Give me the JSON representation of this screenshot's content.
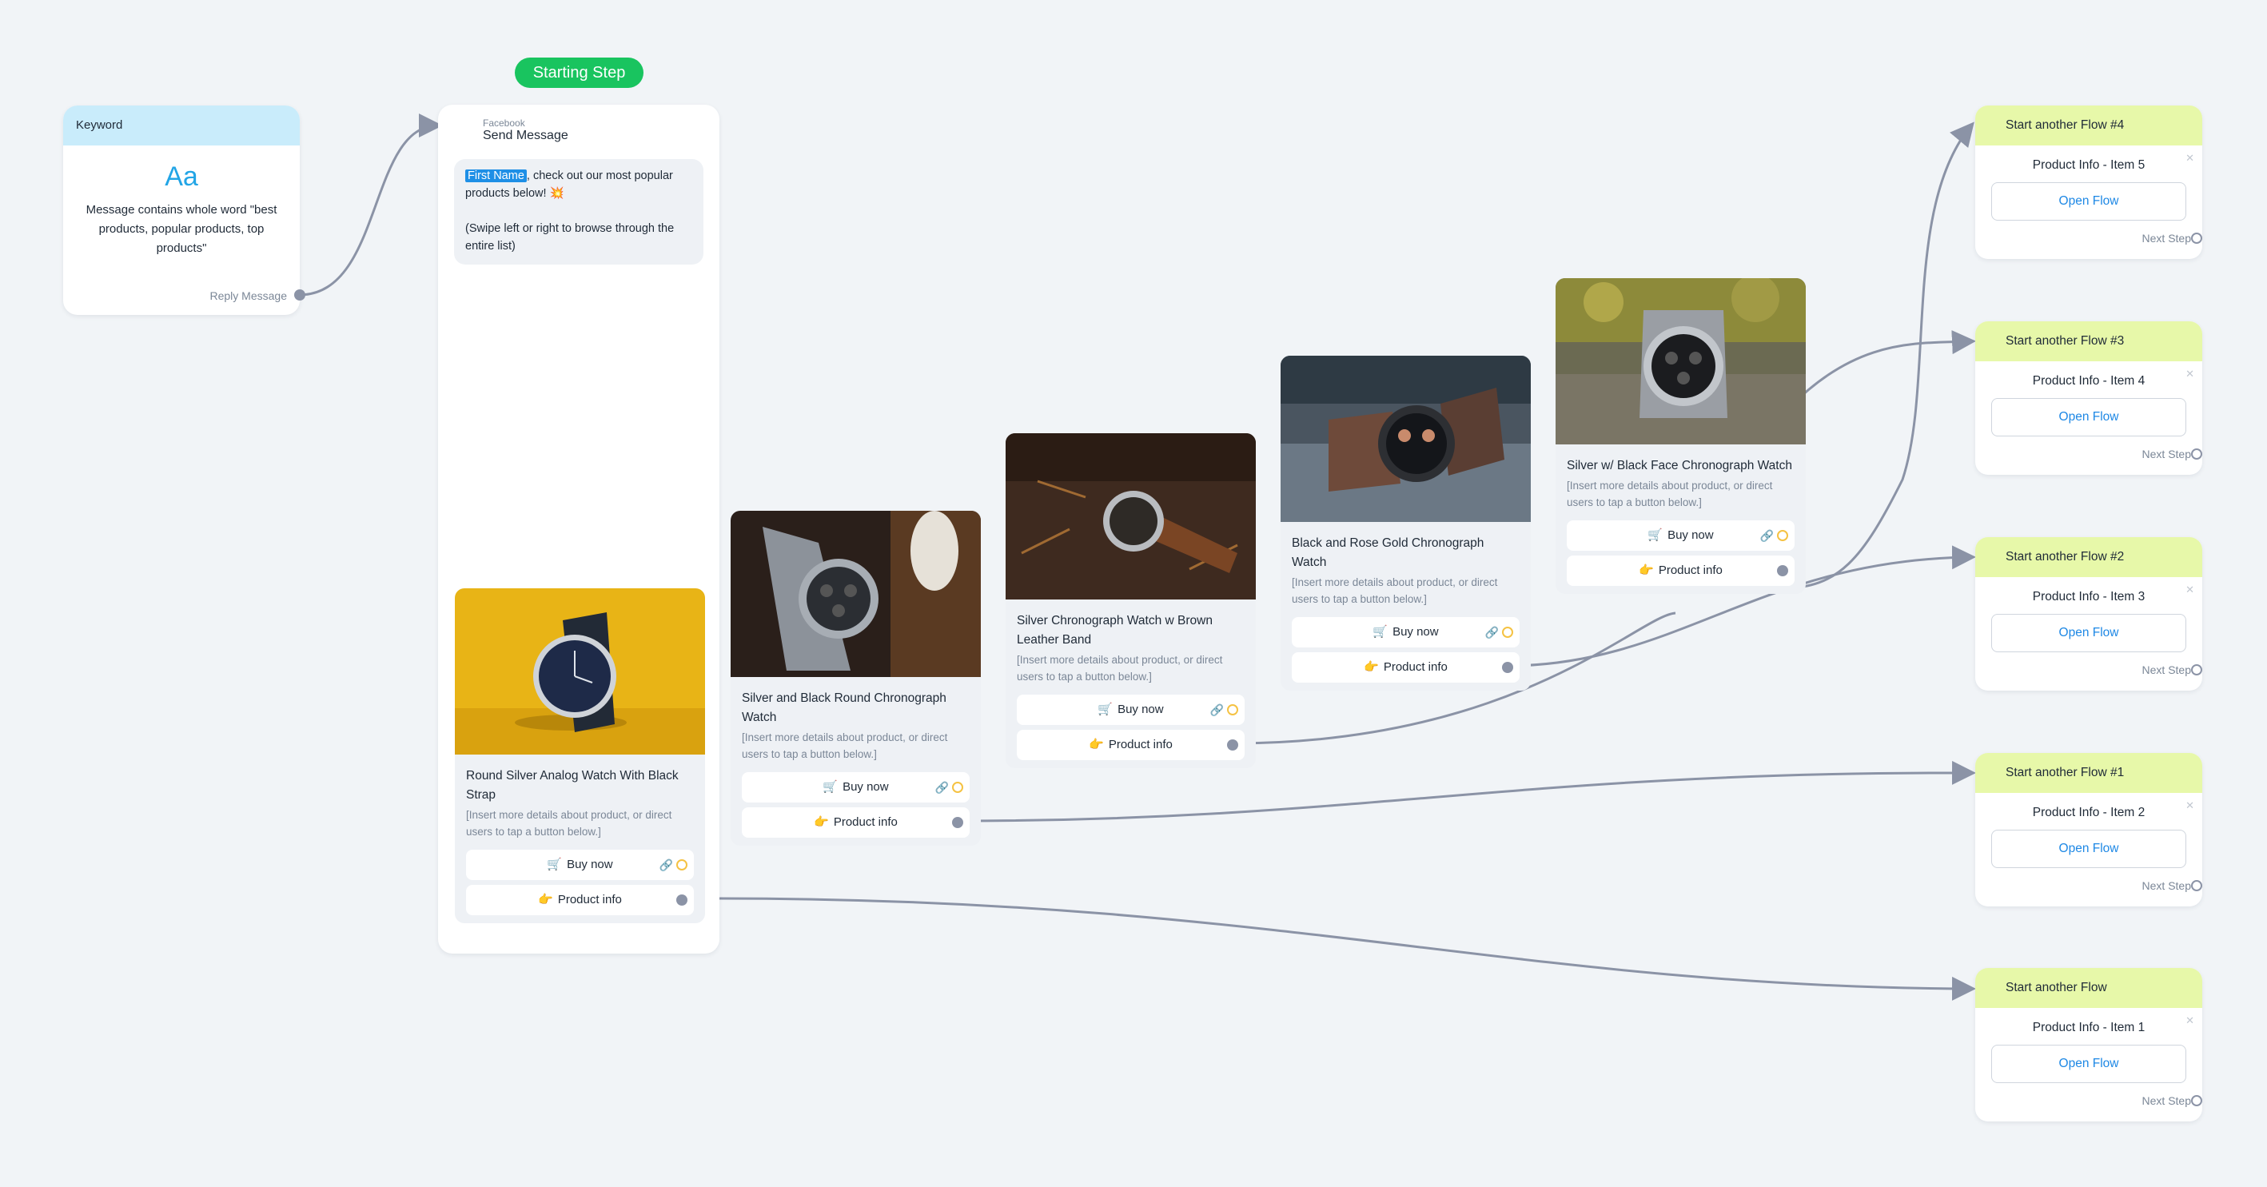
{
  "starting_step": "Starting Step",
  "keyword": {
    "header": "Keyword",
    "icon_text": "Aa",
    "description": "Message contains whole word \"best products, popular products, top products\"",
    "reply_label": "Reply Message"
  },
  "send_message": {
    "channel": "Facebook",
    "title": "Send Message",
    "chip": "First Name",
    "text_after_chip": ", check out our most popular products below! 💥",
    "swipe_text": "(Swipe left or right to browse through the entire list)"
  },
  "products": [
    {
      "title": "Round Silver Analog Watch With Black Strap",
      "desc": "[Insert more details about product, or direct users to tap a button below.]",
      "buy": "Buy now",
      "info": "Product info",
      "buy_icon": "cart-icon",
      "info_icon": "pointing-hand-icon"
    },
    {
      "title": "Silver and Black Round Chronograph Watch",
      "desc": "[Insert more details about product, or direct users to tap a button below.]",
      "buy": "Buy now",
      "info": "Product info",
      "buy_icon": "cart-icon",
      "info_icon": "pointing-hand-icon"
    },
    {
      "title": "Silver Chronograph Watch w Brown Leather Band",
      "desc": "[Insert more details about product, or direct users to tap a button below.]",
      "buy": "Buy now",
      "info": "Product info",
      "buy_icon": "cart-icon",
      "info_icon": "pointing-hand-icon"
    },
    {
      "title": "Black and Rose Gold Chronograph Watch",
      "desc": "[Insert more details about product, or direct users to tap a button below.]",
      "buy": "Buy now",
      "info": "Product info",
      "buy_icon": "cart-icon",
      "info_icon": "pointing-hand-icon"
    },
    {
      "title": "Silver w/ Black Face Chronograph Watch",
      "desc": "[Insert more details about product, or direct users to tap a button below.]",
      "buy": "Buy now",
      "info": "Product info",
      "buy_icon": "cart-icon",
      "info_icon": "pointing-hand-icon"
    }
  ],
  "flows": [
    {
      "header": "Start another Flow #4",
      "item": "Product Info - Item 5",
      "button": "Open Flow",
      "next": "Next Step"
    },
    {
      "header": "Start another Flow #3",
      "item": "Product Info - Item 4",
      "button": "Open Flow",
      "next": "Next Step"
    },
    {
      "header": "Start another Flow #2",
      "item": "Product Info - Item 3",
      "button": "Open Flow",
      "next": "Next Step"
    },
    {
      "header": "Start another Flow #1",
      "item": "Product Info - Item 2",
      "button": "Open Flow",
      "next": "Next Step"
    },
    {
      "header": "Start another Flow",
      "item": "Product Info - Item 1",
      "button": "Open Flow",
      "next": "Next Step"
    }
  ],
  "colors": {
    "starting_step": "#19c45f",
    "keyword_header": "#c9ecfb",
    "flow_header": "#e7f8a9",
    "link": "#1e88e5",
    "connector": "#8b93a6"
  }
}
